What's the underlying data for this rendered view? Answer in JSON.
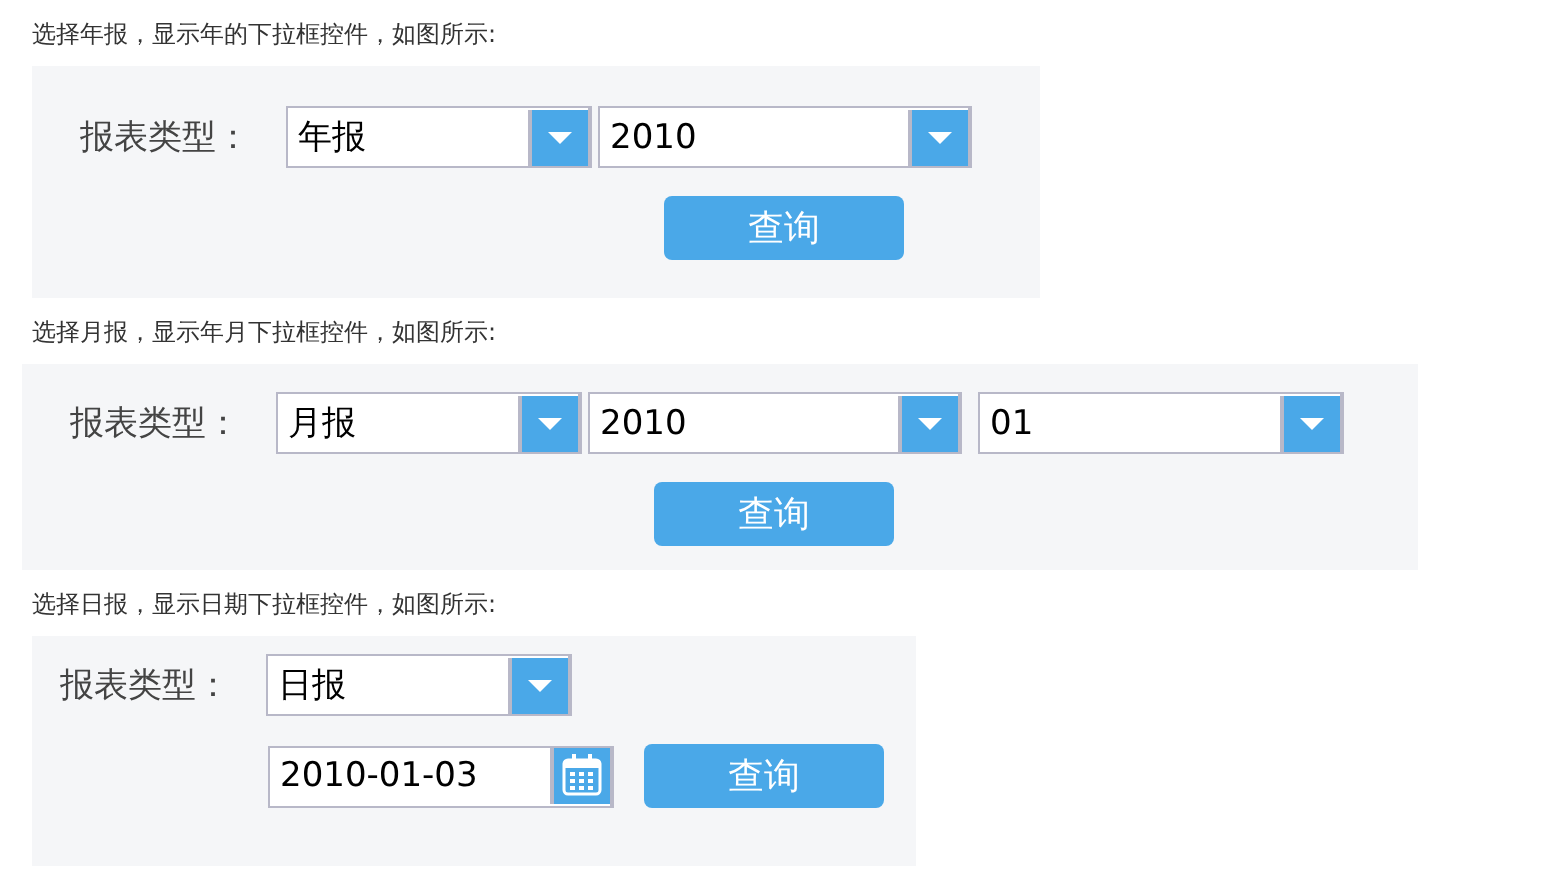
{
  "sections": [
    {
      "caption": "选择年报，显示年的下拉框控件，如图所示:",
      "kind": "row",
      "label": "报表类型：",
      "fields": [
        {
          "kind": "select",
          "value": "年报"
        },
        {
          "kind": "select",
          "value": "2010"
        }
      ],
      "button": "查询"
    },
    {
      "caption": "选择月报，显示年月下拉框控件，如图所示:",
      "kind": "row",
      "label": "报表类型：",
      "fields": [
        {
          "kind": "select",
          "value": "月报"
        },
        {
          "kind": "select",
          "value": "2010"
        },
        {
          "kind": "select",
          "value": "01"
        }
      ],
      "button": "查询"
    },
    {
      "caption": "选择日报，显示日期下拉框控件，如图所示:",
      "kind": "split",
      "label": "报表类型：",
      "fields": [
        {
          "kind": "select",
          "value": "日报"
        },
        {
          "kind": "date",
          "value": "2010-01-03"
        }
      ],
      "button": "查询"
    }
  ]
}
